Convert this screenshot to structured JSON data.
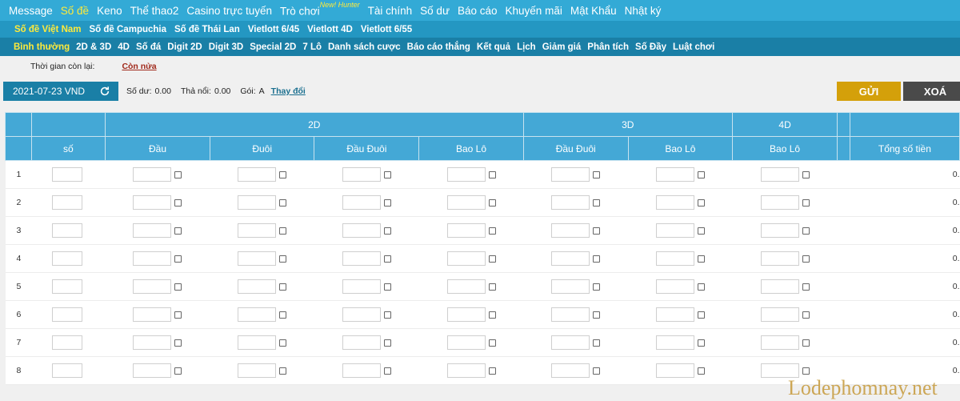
{
  "topnav": {
    "items": [
      "Message",
      "Số đề",
      "Keno",
      "Thể thao2",
      "Casino trực tuyến",
      "Trò chơi",
      "Tài chính",
      "Số dư",
      "Báo cáo",
      "Khuyến mãi",
      "Mật Khẩu",
      "Nhật ký"
    ],
    "active_index": 1,
    "new_badge": "New! Hunter"
  },
  "subnav1": {
    "items": [
      "Số đề Việt Nam",
      "Số đề Campuchia",
      "Số đề Thái Lan",
      "Vietlott 6/45",
      "Vietlott 4D",
      "Vietlott 6/55"
    ],
    "active_index": 0
  },
  "subnav2": {
    "items": [
      "Bình thường",
      "2D & 3D",
      "4D",
      "Số đá",
      "Digit 2D",
      "Digit 3D",
      "Special 2D",
      "7 Lô",
      "Danh sách cược",
      "Báo cáo thắng",
      "Kết quả",
      "Lịch",
      "Giảm giá",
      "Phân tích",
      "Số Đầy",
      "Luật chơi"
    ],
    "active_index": 0
  },
  "timer": {
    "label": "Thời gian còn lại:",
    "value": "Còn nửa"
  },
  "control": {
    "date": "2021-07-23 VND",
    "balance_label": "Số dư:",
    "balance_value": "0.00",
    "float_label": "Thả nổi:",
    "float_value": "0.00",
    "package_label": "Gói:",
    "package_value": "A",
    "change_link": "Thay đổi",
    "send_button": "GỬI",
    "delete_button": "XOÁ"
  },
  "table": {
    "group_headers": [
      "2D",
      "3D",
      "4D"
    ],
    "column_headers": [
      "số",
      "Đầu",
      "Đuôi",
      "Đầu Đuôi",
      "Bao Lô",
      "Đầu Đuôi",
      "Bao Lô",
      "Bao Lô",
      "Tổng số tiền"
    ],
    "rows": [
      "1",
      "2",
      "3",
      "4",
      "5",
      "6",
      "7",
      "8"
    ],
    "total_value": "0."
  },
  "watermark": "Lodephomnay.net"
}
